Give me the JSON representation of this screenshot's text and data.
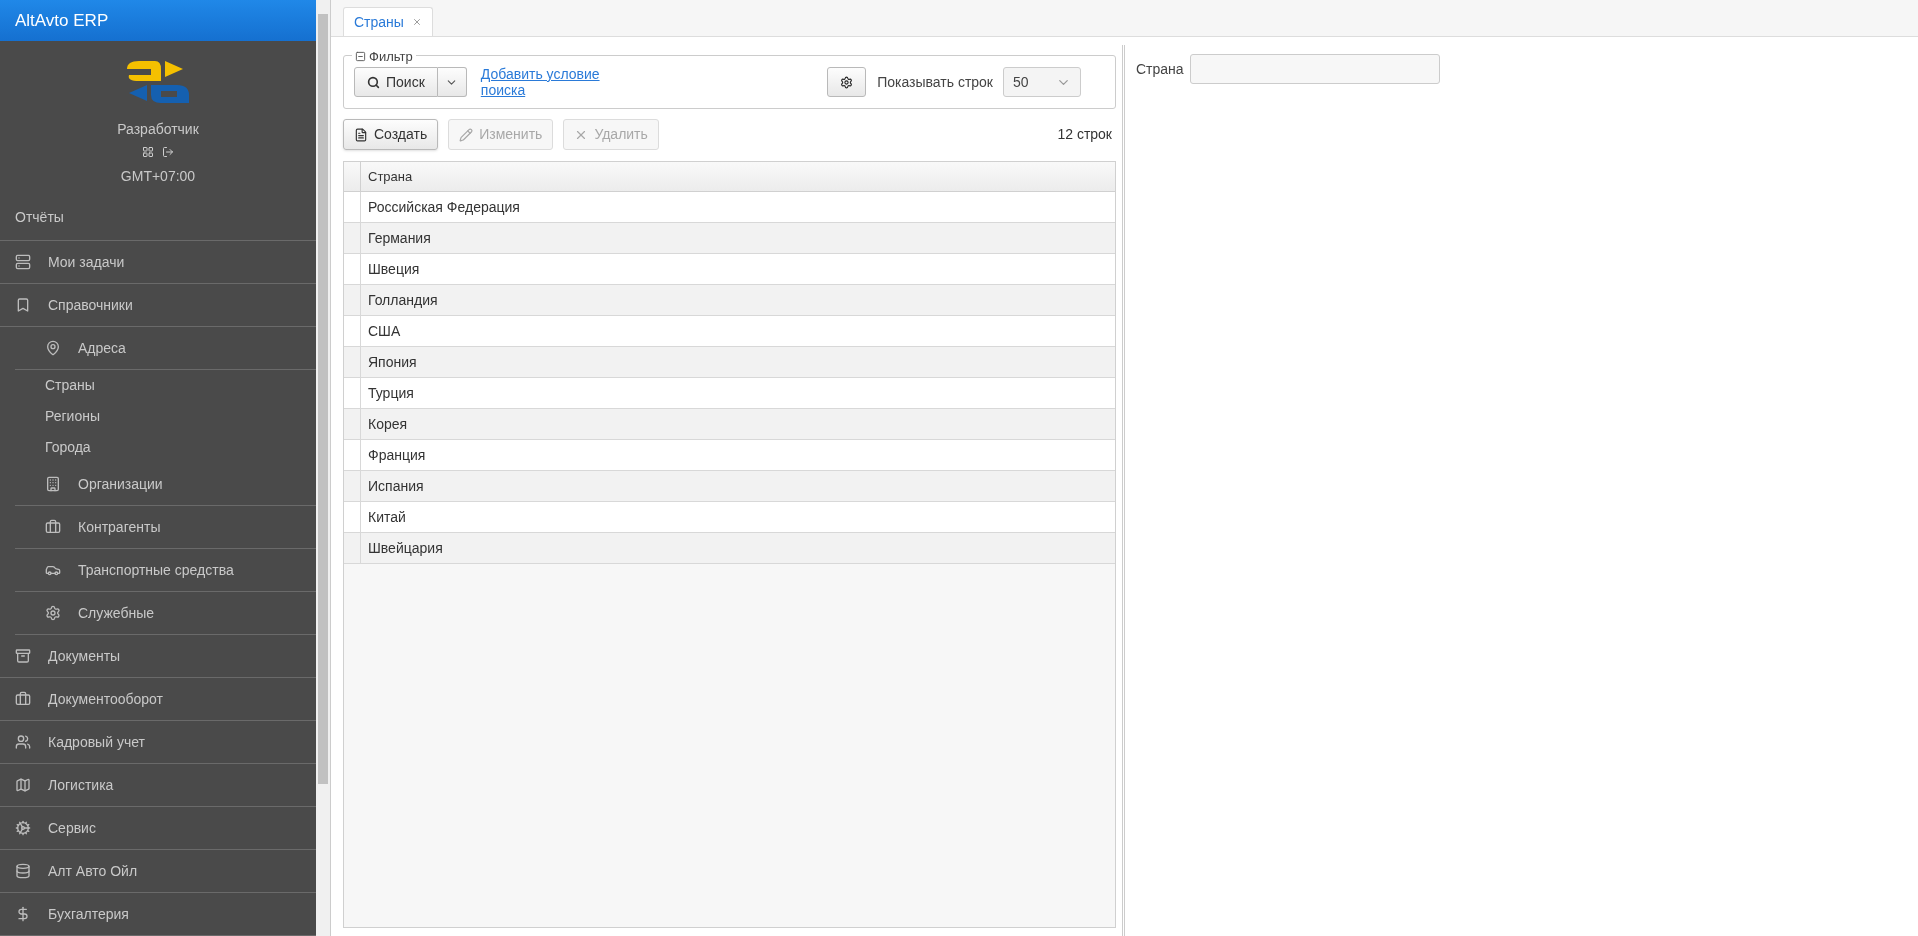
{
  "sidebar": {
    "title": "AltAvto ERP",
    "user": "Разработчик",
    "timezone": "GMT+07:00",
    "items": [
      {
        "label": "Отчёты",
        "kind": "section"
      },
      {
        "label": "Мои задачи",
        "kind": "item"
      },
      {
        "label": "Справочники",
        "kind": "item",
        "children": [
          {
            "label": "Адреса",
            "kind": "item",
            "children": [
              {
                "label": "Страны",
                "kind": "link"
              },
              {
                "label": "Регионы",
                "kind": "link"
              },
              {
                "label": "Города",
                "kind": "link"
              }
            ]
          },
          {
            "label": "Организации",
            "kind": "item"
          },
          {
            "label": "Контрагенты",
            "kind": "item"
          },
          {
            "label": "Транспортные средства",
            "kind": "item"
          },
          {
            "label": "Служебные",
            "kind": "item"
          }
        ]
      },
      {
        "label": "Документы",
        "kind": "item"
      },
      {
        "label": "Документооборот",
        "kind": "item"
      },
      {
        "label": "Кадровый учет",
        "kind": "item"
      },
      {
        "label": "Логистика",
        "kind": "item"
      },
      {
        "label": "Сервис",
        "kind": "item"
      },
      {
        "label": "Алт Авто Ойл",
        "kind": "item"
      },
      {
        "label": "Бухгалтерия",
        "kind": "item"
      }
    ]
  },
  "tabs": [
    {
      "label": "Страны",
      "selected": true
    }
  ],
  "filter": {
    "legend": "Фильтр",
    "expanded": true,
    "search_button": "Поиск",
    "add_condition_link": "Добавить условие поиска",
    "rows_label": "Показывать строк",
    "rows_value": "50"
  },
  "toolbar": {
    "buttons": [
      {
        "label": "Создать",
        "disabled": false
      },
      {
        "label": "Изменить",
        "disabled": true
      },
      {
        "label": "Удалить",
        "disabled": true
      }
    ],
    "row_count": "12 строк"
  },
  "table": {
    "columns": [
      "Страна"
    ],
    "rows": [
      "Российская Федерация",
      "Германия",
      "Швеция",
      "Голландия",
      "США",
      "Япония",
      "Турция",
      "Корея",
      "Франция",
      "Испания",
      "Китай",
      "Швейцария"
    ]
  },
  "detail": {
    "fields": [
      {
        "label": "Страна"
      }
    ]
  }
}
